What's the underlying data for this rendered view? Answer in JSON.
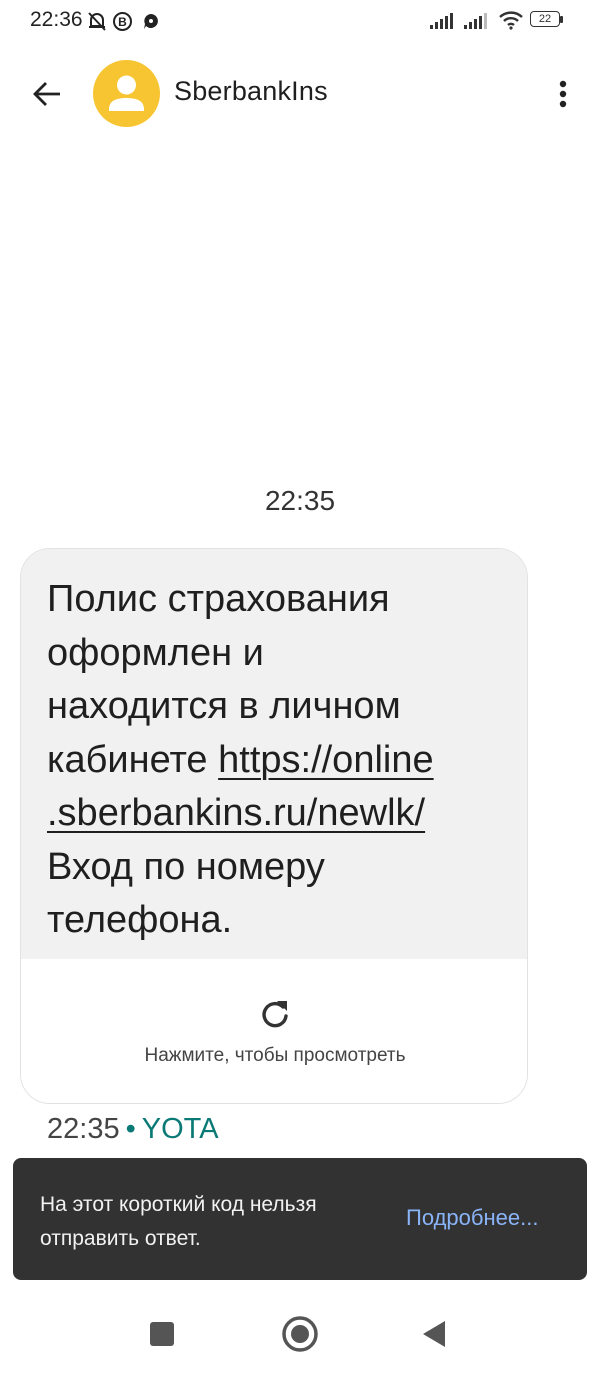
{
  "status_bar": {
    "time": "22:36",
    "battery_level": "22",
    "icons": [
      "mute-bell-icon",
      "b-badge-icon",
      "chat-bubble-icon",
      "signal-icon",
      "signal-icon",
      "wifi-icon",
      "battery-icon"
    ]
  },
  "app_bar": {
    "sender": "SberbankIns",
    "icons": [
      "back-arrow-icon",
      "avatar-person-icon",
      "more-vert-icon"
    ]
  },
  "conversation": {
    "timestamp": "22:35",
    "message": {
      "lines": [
        "Полис страхования",
        "оформлен и",
        "находится в личном",
        "кабинете "
      ],
      "link_part1": "https://online",
      "link_part2": ".sberbankins.ru/newlk/",
      "lines_after": [
        "Вход по номеру",
        "телефона."
      ]
    },
    "preview": {
      "label": "Нажмите, чтобы просмотреть",
      "icon": "refresh-icon"
    },
    "meta": {
      "time": "22:35",
      "separator": "•",
      "carrier": "YOTA"
    }
  },
  "snackbar": {
    "text": "На этот короткий код нельзя отправить ответ.",
    "action": "Подробнее..."
  },
  "nav_bar": {
    "icons": [
      "recents-square-icon",
      "home-circle-icon",
      "back-triangle-icon"
    ]
  },
  "colors": {
    "avatar": "#f7c531",
    "bubble": "#f1f1f1",
    "carrier": "#0b7a77",
    "snackbar": "#323232",
    "snack_action": "#8ab4f8"
  }
}
